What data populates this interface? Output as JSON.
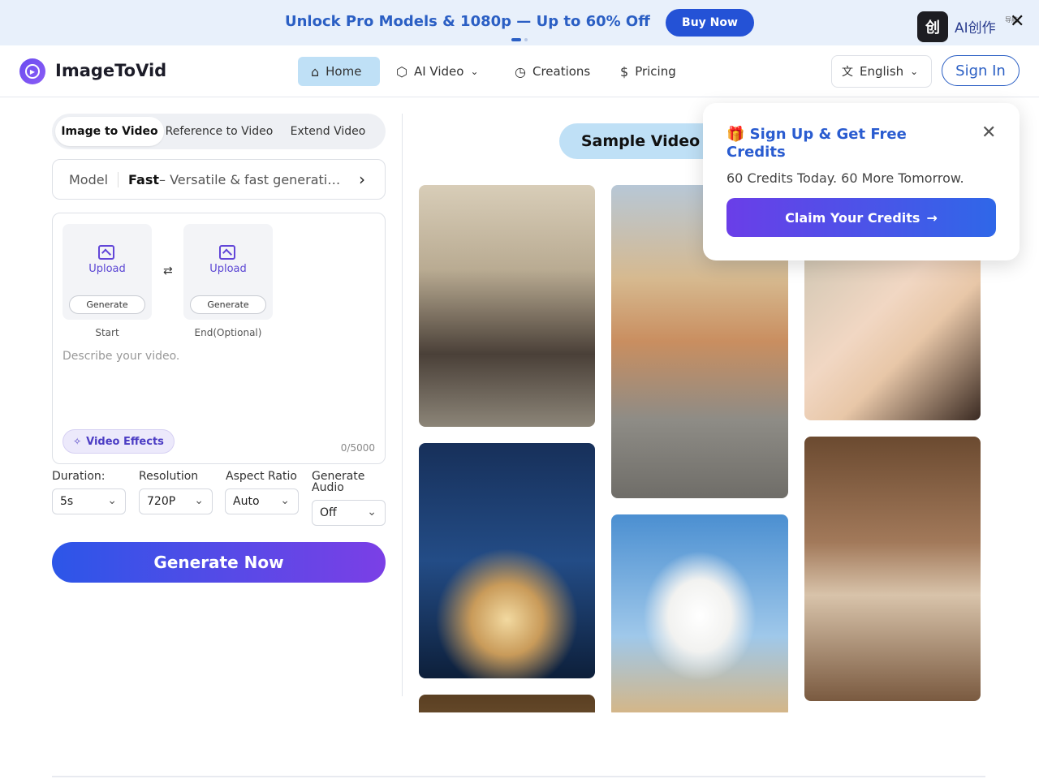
{
  "promo": {
    "text": "Unlock Pro Models & 1080p — Up to 60% Off",
    "buy_label": "Buy Now",
    "badge_text": "AI创作",
    "badge_sub": "导航",
    "close_glyph": "✕"
  },
  "header": {
    "brand": "ImageToVid",
    "nav": [
      {
        "label": "Home",
        "icon": "home-icon"
      },
      {
        "label": "AI Video",
        "icon": "cube-icon"
      },
      {
        "label": "Creations",
        "icon": "clock-icon"
      },
      {
        "label": "Pricing",
        "icon": "dollar-icon"
      }
    ],
    "language": "English",
    "signin_label": "Sign In"
  },
  "editor": {
    "tabs": [
      "Image to Video",
      "Reference to Video",
      "Extend Video"
    ],
    "model_label": "Model",
    "model_name": "Fast",
    "model_desc": " – Versatile & fast generati…",
    "upload_label": "Upload",
    "generate_label": "Generate",
    "start_caption": "Start",
    "end_caption": "End(Optional)",
    "prompt_placeholder": "Describe your video.",
    "effects_label": "Video Effects",
    "counter": "0/5000",
    "options": [
      {
        "label": "Duration:",
        "value": "5s"
      },
      {
        "label": "Resolution",
        "value": "720P"
      },
      {
        "label": "Aspect Ratio",
        "value": "Auto"
      },
      {
        "label": "Generate Audio",
        "value": "Off"
      }
    ],
    "generate_now": "Generate Now"
  },
  "gallery": {
    "sample_label": "Sample Video"
  },
  "popup": {
    "title": "🎁 Sign Up & Get Free Credits",
    "subtitle": "60 Credits Today. 60 More Tomorrow.",
    "claim_label": "Claim Your Credits"
  }
}
